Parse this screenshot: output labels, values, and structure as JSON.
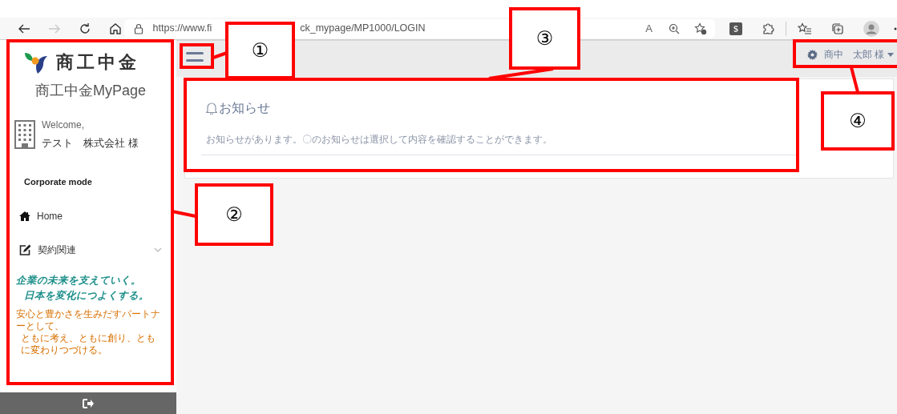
{
  "browser": {
    "nav": [
      {
        "kind": "back",
        "disabled": false
      },
      {
        "kind": "forward",
        "disabled": true
      },
      {
        "kind": "reload",
        "disabled": false
      },
      {
        "kind": "home",
        "disabled": false
      }
    ],
    "read_aloud": "A",
    "url_start": "https://www.fi",
    "url_end": "ck_mypage/MP1000/LOGIN"
  },
  "sidebar": {
    "brand": "商工中金",
    "title": "商工中金MyPage",
    "welcome": "Welcome,",
    "company": "テスト　株式会社 様",
    "mode": "Corporate mode",
    "items": [
      {
        "label": "Home",
        "kind": "home",
        "expandable": false
      },
      {
        "label": "契約関連",
        "kind": "edit",
        "expandable": true
      }
    ],
    "banner": {
      "headline": [
        "企業の未来を支えていく。",
        "日本を変化につよくする。"
      ],
      "tagline": [
        "安心と豊かさを生みだすパートナーとして、",
        "ともに考え、ともに創り、ともに変わりつづける。"
      ]
    }
  },
  "header": {
    "user": "商中　太郎 様"
  },
  "notice": {
    "title": "お知らせ",
    "message": "お知らせがあります。〇のお知らせは選択して内容を確認することができます。"
  },
  "annotations": [
    {
      "label": "①"
    },
    {
      "label": "②"
    },
    {
      "label": "③"
    },
    {
      "label": "④"
    }
  ]
}
